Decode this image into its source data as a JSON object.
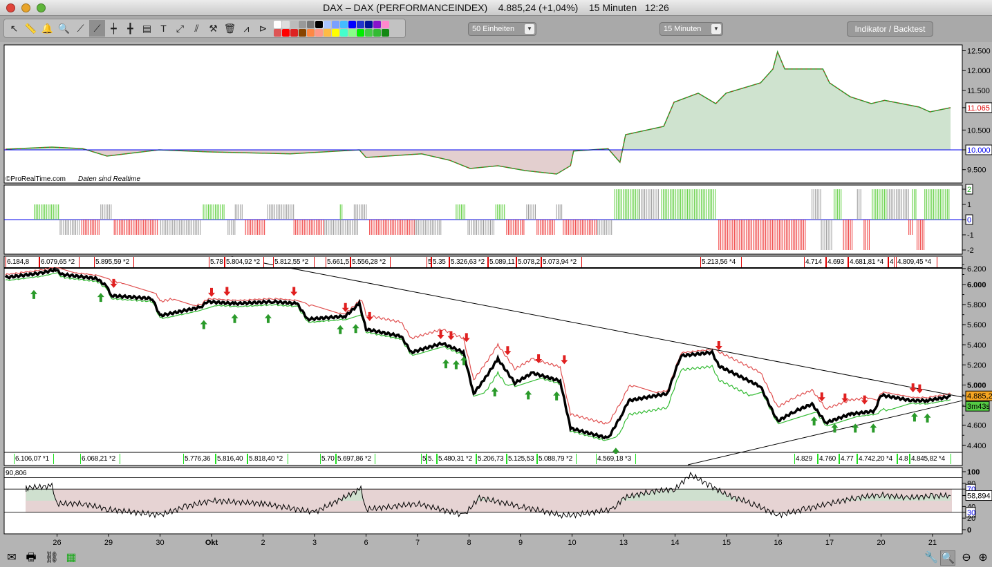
{
  "window": {
    "title": "DAX – DAX (PERFORMANCEINDEX)    4.885,24 (+1,04%)    15 Minuten   12:26"
  },
  "toolbar": {
    "tools": [
      {
        "icon": "pointer-icon",
        "g": "↖"
      },
      {
        "icon": "ruler-icon",
        "g": "📏"
      },
      {
        "icon": "alarm-bell-icon",
        "g": "🔔"
      },
      {
        "icon": "zoom-icon",
        "g": "🔍"
      },
      {
        "icon": "line-icon",
        "g": "⟋"
      },
      {
        "icon": "trendline-icon",
        "g": "⟋"
      },
      {
        "icon": "horizontal-line-icon",
        "g": "┿"
      },
      {
        "icon": "vertical-line-icon",
        "g": "╋"
      },
      {
        "icon": "fibonacci-icon",
        "g": "▤"
      },
      {
        "icon": "text-icon",
        "g": "T"
      },
      {
        "icon": "channel-icon",
        "g": "⤢"
      },
      {
        "icon": "parallel-icon",
        "g": "⫽"
      },
      {
        "icon": "tools-icon",
        "g": "⚒"
      },
      {
        "icon": "trash-icon",
        "g": "🗑"
      },
      {
        "icon": "signal-icon",
        "g": "⩘"
      },
      {
        "icon": "fan-icon",
        "g": "⊳"
      }
    ],
    "colors_top": [
      "#ffffff",
      "#dddddd",
      "#bbbbbb",
      "#999999",
      "#777777",
      "#000000",
      "#aac4ff",
      "#7aa0ff",
      "#44bbff",
      "#0000ff",
      "#2233cc",
      "#001199",
      "#8811cc",
      "#ff88cc"
    ],
    "colors_bottom": [
      "#dd5555",
      "#ff0000",
      "#dd2222",
      "#884400",
      "#ff8844",
      "#ff9988",
      "#ffbb44",
      "#ffff00",
      "#44ffcc",
      "#88ff88",
      "#00ee00",
      "#44cc44",
      "#33bb33",
      "#118811"
    ],
    "units_select": "50 Einheiten",
    "interval_select": "15 Minuten",
    "indicator_button": "Indikator / Backtest"
  },
  "panels": {
    "equity": {
      "watermark": "©ProRealTime.com",
      "realtime_note": "Daten sind Realtime",
      "ticks": [
        "12.500",
        "12.000",
        "11.500",
        "10.500",
        "9.500"
      ],
      "last_value": "11.065",
      "baseline": "10.000"
    },
    "histogram": {
      "ticks": [
        "2",
        "1",
        "0",
        "-1",
        "-2"
      ]
    },
    "price": {
      "ticks": [
        "6.200",
        "6.000",
        "5.800",
        "5.600",
        "5.400",
        "5.200",
        "5.000",
        "4.600",
        "4.400"
      ],
      "last_price": "4.885,2",
      "countdown": "3m43s"
    },
    "rsi": {
      "top_value": "90,806",
      "ticks": [
        "100",
        "80",
        "70",
        "40",
        "30",
        "20",
        "0"
      ],
      "last": "58,894"
    }
  },
  "labels_top": [
    "6.184,8",
    "6.079,65 *2",
    "5.895,59 *2",
    "5.78",
    "5.804,92 *2",
    "5.812,55 *2",
    "5.661,5",
    "5.556,28 *2",
    "5",
    "5.35",
    "5.326,63 *2",
    "5.089,11",
    "5.078,2",
    "5.073,94 *2",
    "5.213,56 *4",
    "4.714",
    "4.693",
    "4.681,81 *4",
    "4",
    "4.809,45 *4"
  ],
  "labels_bottom": [
    "6.106,07 *1",
    "6.068,21 *2",
    "5.776,36",
    "5.816,40",
    "5.818,40 *2",
    "5.70",
    "5.697,86 *2",
    "5",
    "5.",
    "5.480,31 *2",
    "5.206,73",
    "5.125,53",
    "5.088,79 *2",
    "4.569,18 *3",
    "4.829",
    "4.760",
    "4.77",
    "4.742,20 *4",
    "4.8",
    "4.845,82 *4"
  ],
  "xaxis": [
    "26",
    "29",
    "30",
    "Okt",
    "2",
    "3",
    "6",
    "7",
    "8",
    "9",
    "10",
    "13",
    "14",
    "15",
    "16",
    "17",
    "20",
    "21"
  ],
  "chart_data": {
    "type": "line",
    "x_unit": "trading day index (0 = 25 Sep)",
    "price": [
      [
        0,
        6070
      ],
      [
        0.7,
        6115
      ],
      [
        0.97,
        6150
      ],
      [
        1.1,
        6100
      ],
      [
        1.77,
        6060
      ],
      [
        1.97,
        5980
      ],
      [
        2.04,
        5890
      ],
      [
        2.85,
        5860
      ],
      [
        3.0,
        5690
      ],
      [
        3.79,
        5775
      ],
      [
        3.92,
        5830
      ],
      [
        4.46,
        5810
      ],
      [
        5.19,
        5830
      ],
      [
        5.66,
        5810
      ],
      [
        5.87,
        5655
      ],
      [
        6.6,
        5685
      ],
      [
        6.87,
        5810
      ],
      [
        7.0,
        5555
      ],
      [
        7.68,
        5485
      ],
      [
        7.88,
        5325
      ],
      [
        8.48,
        5415
      ],
      [
        8.89,
        5325
      ],
      [
        9.09,
        4915
      ],
      [
        9.29,
        5050
      ],
      [
        9.56,
        5260
      ],
      [
        9.89,
        5020
      ],
      [
        10.23,
        5120
      ],
      [
        10.77,
        5040
      ],
      [
        10.97,
        4570
      ],
      [
        11.7,
        4470
      ],
      [
        11.97,
        4710
      ],
      [
        12.1,
        4845
      ],
      [
        12.85,
        4915
      ],
      [
        13.11,
        5290
      ],
      [
        13.72,
        5325
      ],
      [
        13.85,
        5190
      ],
      [
        14.66,
        4985
      ],
      [
        14.99,
        4640
      ],
      [
        15.33,
        4740
      ],
      [
        15.66,
        4810
      ],
      [
        15.93,
        4625
      ],
      [
        16.4,
        4710
      ],
      [
        16.87,
        4740
      ],
      [
        17.0,
        4900
      ],
      [
        17.6,
        4845
      ],
      [
        17.88,
        4845
      ],
      [
        18.35,
        4885
      ]
    ],
    "sell_signals": [
      [
        1.0,
        6160
      ],
      [
        2.1,
        5960
      ],
      [
        4.0,
        5870
      ],
      [
        4.3,
        5880
      ],
      [
        5.6,
        5880
      ],
      [
        6.6,
        5720
      ],
      [
        7.07,
        5630
      ],
      [
        8.45,
        5450
      ],
      [
        8.65,
        5440
      ],
      [
        8.95,
        5420
      ],
      [
        9.75,
        5290
      ],
      [
        10.35,
        5210
      ],
      [
        10.85,
        5200
      ],
      [
        13.85,
        5340
      ],
      [
        15.85,
        4830
      ],
      [
        16.3,
        4820
      ],
      [
        16.68,
        4800
      ],
      [
        17.62,
        4920
      ],
      [
        17.75,
        4910
      ]
    ],
    "buy_signals": [
      [
        0.55,
        5960
      ],
      [
        1.85,
        5930
      ],
      [
        3.85,
        5660
      ],
      [
        4.45,
        5720
      ],
      [
        5.1,
        5720
      ],
      [
        6.5,
        5610
      ],
      [
        6.8,
        5620
      ],
      [
        8.55,
        5270
      ],
      [
        8.75,
        5260
      ],
      [
        8.9,
        5300
      ],
      [
        9.5,
        4990
      ],
      [
        10.15,
        4960
      ],
      [
        10.7,
        4950
      ],
      [
        11.85,
        4390
      ],
      [
        15.7,
        4700
      ],
      [
        16.1,
        4630
      ],
      [
        16.5,
        4630
      ],
      [
        16.85,
        4630
      ],
      [
        17.65,
        4740
      ],
      [
        17.9,
        4730
      ]
    ],
    "trendlines": [
      [
        [
          4.39,
          6275
        ],
        [
          18.58,
          4880
        ]
      ],
      [
        [
          13.25,
          4206
        ],
        [
          18.58,
          4845
        ]
      ]
    ],
    "equity": [
      [
        0,
        10017
      ],
      [
        0.9,
        10070
      ],
      [
        1.5,
        10030
      ],
      [
        1.97,
        9843
      ],
      [
        2.98,
        10000
      ],
      [
        3.92,
        9950
      ],
      [
        5.53,
        9900
      ],
      [
        6.87,
        10000
      ],
      [
        7.0,
        9808
      ],
      [
        8.08,
        9900
      ],
      [
        8.62,
        9739
      ],
      [
        9.02,
        9530
      ],
      [
        9.56,
        9600
      ],
      [
        10.09,
        9477
      ],
      [
        10.7,
        9390
      ],
      [
        10.97,
        9600
      ],
      [
        11.03,
        9970
      ],
      [
        11.7,
        10030
      ],
      [
        11.93,
        9686
      ],
      [
        12.04,
        10383
      ],
      [
        12.78,
        10592
      ],
      [
        12.98,
        11202
      ],
      [
        13.45,
        11430
      ],
      [
        13.79,
        11167
      ],
      [
        13.99,
        11430
      ],
      [
        14.66,
        11690
      ],
      [
        14.9,
        12038
      ],
      [
        14.99,
        12474
      ],
      [
        15.13,
        12040
      ],
      [
        15.46,
        12040
      ],
      [
        15.87,
        12040
      ],
      [
        16.0,
        11690
      ],
      [
        16.4,
        11341
      ],
      [
        16.81,
        11167
      ],
      [
        17.07,
        11250
      ],
      [
        17.74,
        11080
      ],
      [
        17.95,
        10958
      ],
      [
        18.35,
        11065
      ]
    ],
    "histogram_runs": [
      [
        0.56,
        1.03,
        1,
        "g"
      ],
      [
        1.06,
        1.44,
        -1,
        "n"
      ],
      [
        1.48,
        1.84,
        -1,
        "r"
      ],
      [
        1.85,
        2.08,
        1,
        "n"
      ],
      [
        2.11,
        2.98,
        -1,
        "r"
      ],
      [
        3.01,
        3.79,
        -1,
        "n"
      ],
      [
        3.84,
        4.26,
        1,
        "g"
      ],
      [
        4.32,
        4.46,
        -1,
        "n"
      ],
      [
        4.46,
        4.62,
        1,
        "n"
      ],
      [
        4.66,
        5.06,
        -1,
        "r"
      ],
      [
        5.09,
        5.6,
        1,
        "n"
      ],
      [
        5.6,
        6.2,
        -1,
        "r"
      ],
      [
        6.2,
        6.87,
        -1,
        "n"
      ],
      [
        6.5,
        6.56,
        1,
        "g"
      ],
      [
        6.77,
        7.03,
        1,
        "n"
      ],
      [
        7.07,
        7.95,
        -1,
        "r"
      ],
      [
        7.95,
        8.48,
        -1,
        "n"
      ],
      [
        8.75,
        8.95,
        1,
        "g"
      ],
      [
        8.98,
        9.49,
        -1,
        "n"
      ],
      [
        9.52,
        9.69,
        1,
        "g"
      ],
      [
        9.73,
        10.09,
        -1,
        "r"
      ],
      [
        10.12,
        10.3,
        1,
        "n"
      ],
      [
        10.32,
        10.67,
        -1,
        "r"
      ],
      [
        10.7,
        10.83,
        1,
        "n"
      ],
      [
        10.83,
        11.5,
        -1,
        "r"
      ],
      [
        11.5,
        11.8,
        -1,
        "n"
      ],
      [
        11.83,
        12.31,
        2,
        "g"
      ],
      [
        12.31,
        12.71,
        2,
        "n"
      ],
      [
        12.74,
        13.79,
        2,
        "g"
      ],
      [
        13.85,
        15.53,
        -2,
        "r"
      ],
      [
        15.66,
        15.84,
        2,
        "n"
      ],
      [
        15.84,
        16.07,
        -2,
        "n"
      ],
      [
        16.09,
        16.23,
        2,
        "g"
      ],
      [
        16.27,
        16.47,
        -2,
        "r"
      ],
      [
        16.54,
        16.64,
        2,
        "n"
      ],
      [
        16.67,
        16.78,
        -2,
        "r"
      ],
      [
        16.83,
        17.13,
        2,
        "g"
      ],
      [
        17.13,
        17.54,
        2,
        "n"
      ],
      [
        17.54,
        17.61,
        -1,
        "r"
      ],
      [
        17.61,
        17.68,
        2,
        "g"
      ],
      [
        17.7,
        17.84,
        -2,
        "r"
      ],
      [
        17.85,
        18.35,
        2,
        "g"
      ]
    ],
    "rsi": [
      [
        0,
        70
      ],
      [
        0.9,
        75
      ],
      [
        1.0,
        45
      ],
      [
        1.5,
        45
      ],
      [
        2.0,
        35
      ],
      [
        3.0,
        25
      ],
      [
        3.5,
        40
      ],
      [
        4,
        50
      ],
      [
        5,
        45
      ],
      [
        6,
        30
      ],
      [
        6.9,
        70
      ],
      [
        7.0,
        35
      ],
      [
        7.5,
        40
      ],
      [
        8,
        45
      ],
      [
        8.9,
        25
      ],
      [
        9.2,
        55
      ],
      [
        10,
        40
      ],
      [
        10.8,
        25
      ],
      [
        11,
        25
      ],
      [
        11.8,
        35
      ],
      [
        12,
        55
      ],
      [
        12.5,
        65
      ],
      [
        13,
        70
      ],
      [
        13.3,
        95
      ],
      [
        13.7,
        75
      ],
      [
        14,
        60
      ],
      [
        14.5,
        45
      ],
      [
        15,
        25
      ],
      [
        15.5,
        35
      ],
      [
        16,
        45
      ],
      [
        16.5,
        55
      ],
      [
        17,
        60
      ],
      [
        17.5,
        55
      ],
      [
        18,
        58
      ],
      [
        18.35,
        58.9
      ]
    ],
    "colors": {
      "up": "#2a9a2a",
      "down": "#e02020",
      "neutral": "#999999",
      "baseline": "#0000ee"
    }
  }
}
